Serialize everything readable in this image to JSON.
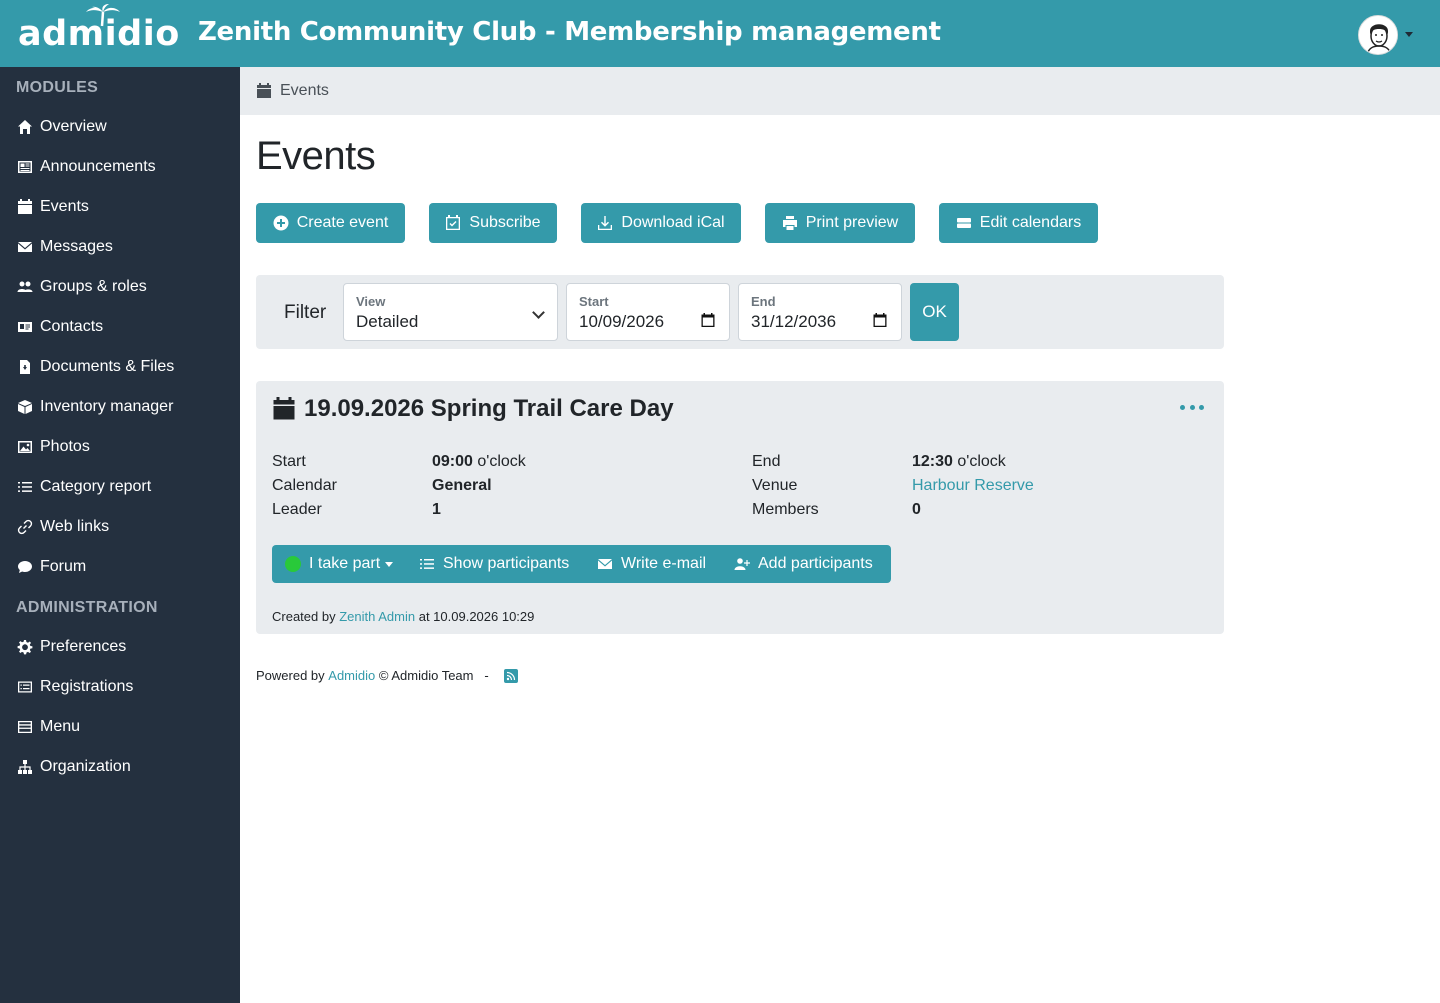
{
  "header": {
    "logo_text": "admidio",
    "site_title": "Zenith Community Club - Membership management"
  },
  "sidebar": {
    "modules_heading": "MODULES",
    "admin_heading": "ADMINISTRATION",
    "modules": [
      {
        "label": "Overview",
        "icon": "home-icon"
      },
      {
        "label": "Announcements",
        "icon": "newspaper-icon"
      },
      {
        "label": "Events",
        "icon": "calendar-icon"
      },
      {
        "label": "Messages",
        "icon": "envelope-icon"
      },
      {
        "label": "Groups & roles",
        "icon": "people-icon"
      },
      {
        "label": "Contacts",
        "icon": "vcard-icon"
      },
      {
        "label": "Documents & Files",
        "icon": "file-icon"
      },
      {
        "label": "Inventory manager",
        "icon": "box-icon"
      },
      {
        "label": "Photos",
        "icon": "image-icon"
      },
      {
        "label": "Category report",
        "icon": "list-icon"
      },
      {
        "label": "Web links",
        "icon": "link-icon"
      },
      {
        "label": "Forum",
        "icon": "chat-icon"
      }
    ],
    "admin": [
      {
        "label": "Preferences",
        "icon": "gear-icon"
      },
      {
        "label": "Registrations",
        "icon": "card-list-icon"
      },
      {
        "label": "Menu",
        "icon": "menu-icon"
      },
      {
        "label": "Organization",
        "icon": "diagram-icon"
      }
    ]
  },
  "breadcrumb": {
    "label": "Events"
  },
  "page_title": "Events",
  "toolbar": {
    "create": "Create event",
    "subscribe": "Subscribe",
    "download": "Download iCal",
    "print": "Print preview",
    "edit": "Edit calendars"
  },
  "filter": {
    "label": "Filter",
    "view_label": "View",
    "view_value": "Detailed",
    "start_label": "Start",
    "start_value": "10/09/2026",
    "end_label": "End",
    "end_value": "31/12/2036",
    "ok": "OK"
  },
  "event": {
    "title": "19.09.2026 Spring Trail Care Day",
    "start_label": "Start",
    "start_time": "09:00",
    "start_suffix": "o'clock",
    "end_label": "End",
    "end_time": "12:30",
    "end_suffix": "o'clock",
    "calendar_label": "Calendar",
    "calendar_value": "General",
    "venue_label": "Venue",
    "venue_value": "Harbour Reserve",
    "leader_label": "Leader",
    "leader_value": "1",
    "members_label": "Members",
    "members_value": "0",
    "actions": {
      "take_part": "I take part",
      "show_participants": "Show participants",
      "write_email": "Write e-mail",
      "add_participants": "Add participants"
    },
    "created_prefix": "Created by",
    "created_by": "Zenith Admin",
    "created_at": "at 10.09.2026 10:29"
  },
  "footer": {
    "prefix": "Powered by",
    "link": "Admidio",
    "suffix": "© Admidio Team",
    "sep": "-"
  },
  "colors": {
    "accent": "#349aaa",
    "sidebar": "#24303f",
    "panel": "#e9ecef",
    "status_green": "#29c93a"
  }
}
